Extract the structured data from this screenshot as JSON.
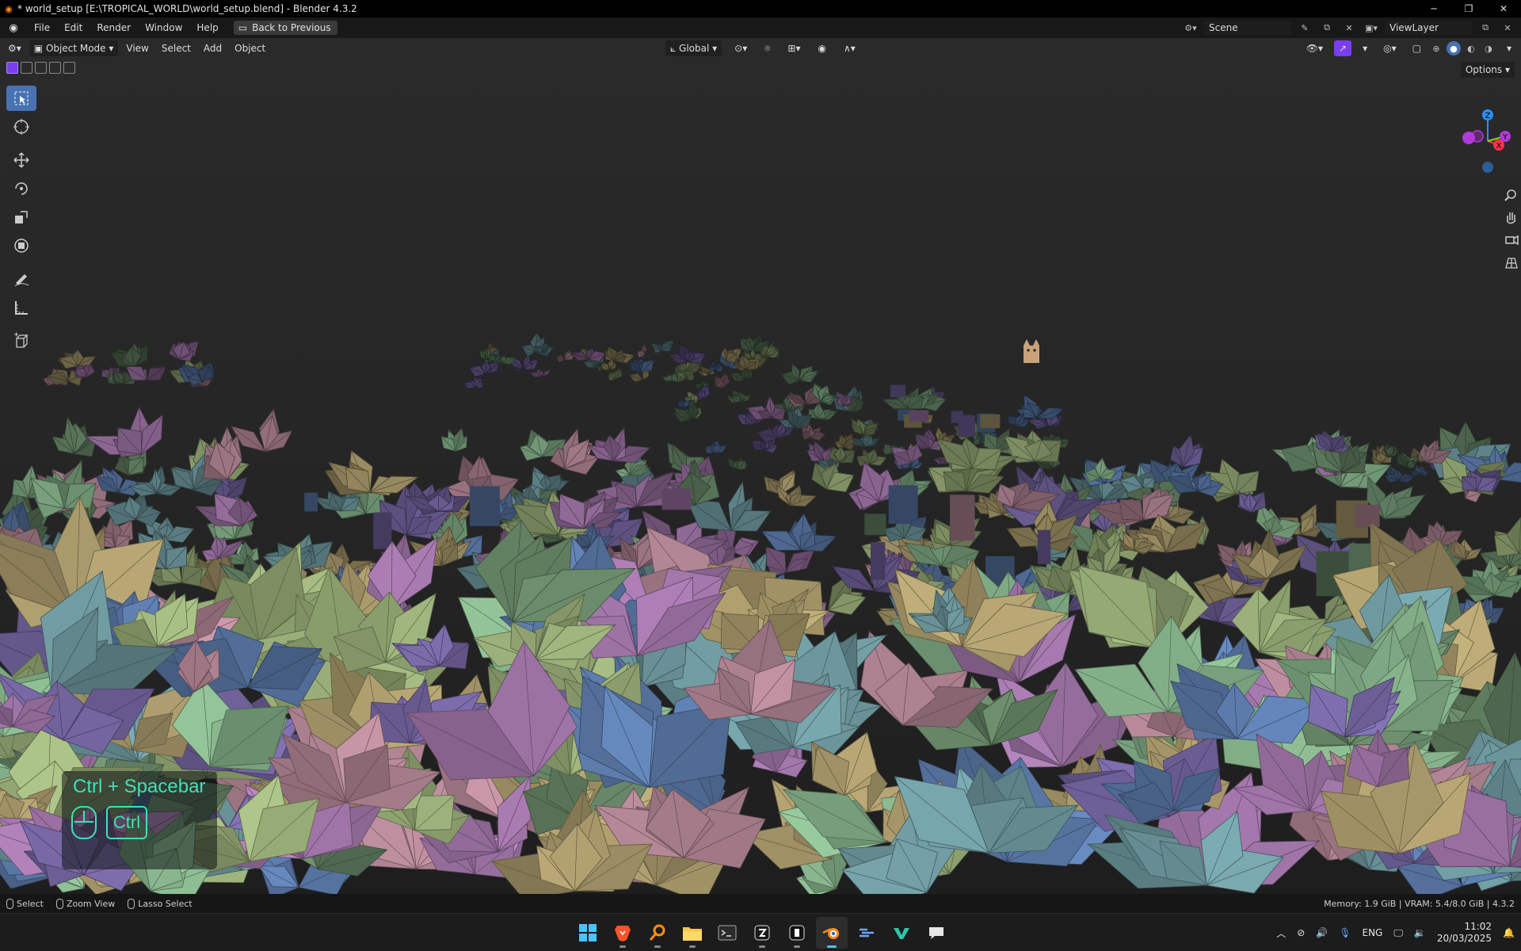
{
  "window": {
    "title": "* world_setup [E:\\TROPICAL_WORLD\\world_setup.blend] - Blender 4.3.2",
    "controls": [
      "─",
      "❐",
      "✕"
    ]
  },
  "menu": {
    "items": [
      "File",
      "Edit",
      "Render",
      "Window",
      "Help"
    ],
    "back_button": "Back to Previous",
    "scene_label": "Scene",
    "view_layer_label": "ViewLayer"
  },
  "viewport_header": {
    "mode": "Object Mode",
    "menus": [
      "View",
      "Select",
      "Add",
      "Object"
    ],
    "orientation": "Global",
    "options": "Options"
  },
  "toolbar": {
    "tools": [
      "select-box",
      "cursor",
      "move",
      "rotate",
      "scale",
      "transform",
      "annotate",
      "measure",
      "add-cube"
    ],
    "active": "select-box"
  },
  "gizmo": {
    "axes": [
      "Z",
      "X",
      "Y"
    ],
    "colors": {
      "x": "#ff3352",
      "y": "#8bdc00",
      "z": "#2890ff",
      "neg_y_purple": "#b13bd6"
    }
  },
  "key_overlay": {
    "combo": "Ctrl + Spacebar",
    "key": "Ctrl",
    "color": "#3fe0b8"
  },
  "statusbar": {
    "hints": [
      "Select",
      "Zoom View",
      "Lasso Select"
    ],
    "stats": "Memory: 1.9 GiB | VRAM: 5.4/8.0 GiB | 4.3.2"
  },
  "taskbar": {
    "apps": [
      "windows-start",
      "brave",
      "search",
      "file-explorer",
      "terminal",
      "app-5",
      "app-6",
      "blender",
      "app-8",
      "app-9",
      "app-10"
    ],
    "active_app": "blender",
    "tray": {
      "language": "ENG",
      "time": "11:02",
      "date": "20/03/2025"
    }
  },
  "scene": {
    "leaf_colors": [
      "#a87bb0",
      "#7a6aa8",
      "#8ab88f",
      "#9bb07a",
      "#6f9aa0",
      "#b88a9a",
      "#6a8a6a",
      "#b0a070",
      "#5f7fb0"
    ]
  }
}
